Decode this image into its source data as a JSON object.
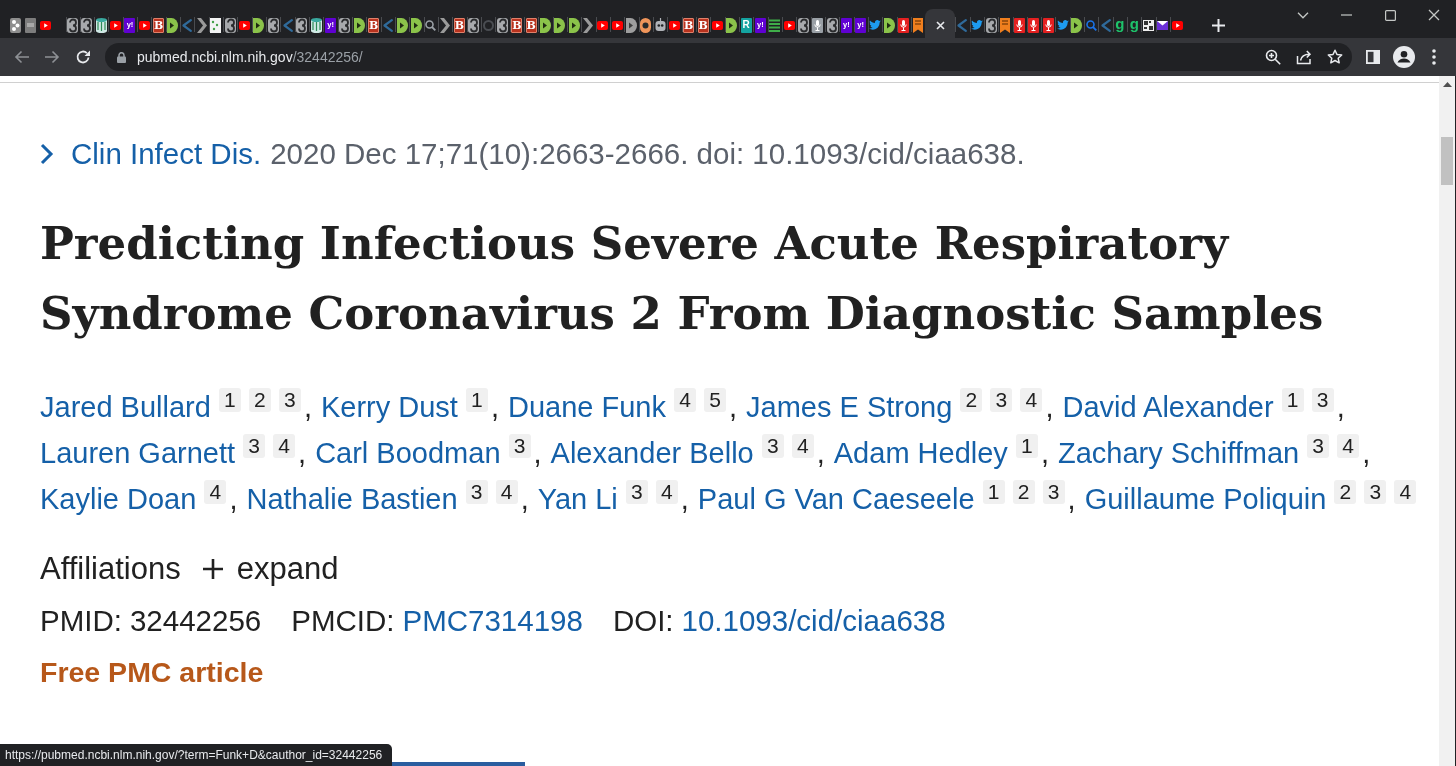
{
  "tab_strip": {
    "pinned_tabs": [
      {
        "kind": "dots-tile",
        "selected": false
      },
      {
        "kind": "gray-tile",
        "selected": false
      },
      {
        "kind": "youtube",
        "selected": false
      }
    ],
    "tabs": [
      {
        "kind": "swirl",
        "selected": false
      },
      {
        "kind": "swirl",
        "selected": false
      },
      {
        "kind": "cylinder",
        "selected": false
      },
      {
        "kind": "youtube",
        "selected": false
      },
      {
        "kind": "yahoo",
        "glyph": "y!",
        "selected": false
      },
      {
        "kind": "youtube",
        "selected": false
      },
      {
        "kind": "b-tile",
        "glyph": "B",
        "selected": false
      },
      {
        "kind": "green-play",
        "selected": false
      },
      {
        "kind": "blue-chevron",
        "selected": false
      },
      {
        "kind": "gray-chevron",
        "selected": false
      },
      {
        "kind": "doc",
        "selected": false
      },
      {
        "kind": "swirl",
        "selected": false
      },
      {
        "kind": "youtube",
        "selected": false
      },
      {
        "kind": "green-play",
        "selected": false
      },
      {
        "kind": "swirl",
        "selected": false
      },
      {
        "kind": "blue-chevron",
        "selected": false
      },
      {
        "kind": "swirl",
        "selected": false
      },
      {
        "kind": "cylinder",
        "selected": false
      },
      {
        "kind": "yahoo",
        "glyph": "y!",
        "selected": false
      },
      {
        "kind": "swirl",
        "selected": false
      },
      {
        "kind": "green-play",
        "selected": false
      },
      {
        "kind": "b-tile",
        "glyph": "B",
        "selected": false
      },
      {
        "kind": "blue-chevron",
        "selected": false
      },
      {
        "kind": "green-play",
        "selected": false
      },
      {
        "kind": "green-play",
        "selected": false
      },
      {
        "kind": "search",
        "selected": false
      },
      {
        "kind": "gray-chevron",
        "selected": false
      },
      {
        "kind": "b-tile",
        "glyph": "B",
        "selected": false
      },
      {
        "kind": "swirl",
        "selected": false
      },
      {
        "kind": "ring",
        "selected": false
      },
      {
        "kind": "swirl",
        "selected": false
      },
      {
        "kind": "b-tile",
        "glyph": "B",
        "selected": false
      },
      {
        "kind": "b-tile",
        "glyph": "B",
        "selected": false
      },
      {
        "kind": "green-play",
        "selected": false
      },
      {
        "kind": "green-play",
        "selected": false
      },
      {
        "kind": "green-play",
        "selected": false
      },
      {
        "kind": "gray-chevron",
        "selected": false
      },
      {
        "kind": "youtube",
        "selected": false
      },
      {
        "kind": "youtube",
        "selected": false
      },
      {
        "kind": "gray-play",
        "selected": false
      },
      {
        "kind": "orange-ring",
        "selected": false
      },
      {
        "kind": "robot",
        "selected": false
      },
      {
        "kind": "youtube",
        "selected": false
      },
      {
        "kind": "b-tile",
        "glyph": "B",
        "selected": false
      },
      {
        "kind": "b-tile",
        "glyph": "B",
        "selected": false
      },
      {
        "kind": "youtube",
        "selected": false
      },
      {
        "kind": "green-play",
        "selected": false
      },
      {
        "kind": "r-tile",
        "glyph": "R",
        "selected": false
      },
      {
        "kind": "yahoo",
        "glyph": "y!",
        "selected": false
      },
      {
        "kind": "list",
        "selected": false
      },
      {
        "kind": "youtube",
        "selected": false
      },
      {
        "kind": "swirl",
        "selected": false
      },
      {
        "kind": "mic-gray",
        "selected": false
      },
      {
        "kind": "swirl",
        "selected": false
      },
      {
        "kind": "yahoo",
        "glyph": "y!",
        "selected": false
      },
      {
        "kind": "yahoo",
        "glyph": "y!",
        "selected": false
      },
      {
        "kind": "twitter",
        "selected": false
      },
      {
        "kind": "green-play",
        "selected": false
      },
      {
        "kind": "mic",
        "selected": false
      },
      {
        "kind": "bookmark",
        "selected": false
      },
      {
        "selected": true
      },
      {
        "kind": "blue-chevron",
        "selected": false
      },
      {
        "kind": "twitter",
        "selected": false
      },
      {
        "kind": "swirl",
        "selected": false
      },
      {
        "kind": "bookmark",
        "selected": false
      },
      {
        "kind": "mic",
        "selected": false
      },
      {
        "kind": "mic",
        "selected": false
      },
      {
        "kind": "mic",
        "selected": false
      },
      {
        "kind": "twitter",
        "selected": false
      },
      {
        "kind": "green-play",
        "selected": false
      },
      {
        "kind": "search-blue",
        "selected": false
      },
      {
        "kind": "blue-chevron",
        "selected": false
      },
      {
        "kind": "g-letter",
        "glyph": "g",
        "selected": false
      },
      {
        "kind": "g-letter",
        "glyph": "g",
        "selected": false
      },
      {
        "kind": "pattern",
        "selected": false
      },
      {
        "kind": "mail",
        "selected": false
      },
      {
        "kind": "youtube",
        "selected": false
      }
    ]
  },
  "toolbar": {
    "address_bar": {
      "host": "pubmed.ncbi.nlm.nih.gov",
      "path": "/32442256/"
    }
  },
  "article": {
    "journal": "Clin Infect Dis.",
    "citation": "2020 Dec 17;71(10):2663-2666. doi: 10.1093/cid/ciaa638.",
    "title": "Predicting Infectious Severe Acute Respiratory Syndrome Coronavirus 2 From Diagnostic Samples",
    "authors": [
      {
        "name": "Jared Bullard",
        "affiliations": [
          "1",
          "2",
          "3"
        ],
        "separator": ","
      },
      {
        "name": "Kerry Dust",
        "affiliations": [
          "1"
        ],
        "separator": ","
      },
      {
        "name": "Duane Funk",
        "affiliations": [
          "4",
          "5"
        ],
        "separator": ","
      },
      {
        "name": "James E Strong",
        "affiliations": [
          "2",
          "3",
          "4"
        ],
        "separator": ","
      },
      {
        "name": "David Alexander",
        "affiliations": [
          "1",
          "3"
        ],
        "separator": ","
      },
      {
        "name": "Lauren Garnett",
        "affiliations": [
          "3",
          "4"
        ],
        "separator": ","
      },
      {
        "name": "Carl Boodman",
        "affiliations": [
          "3"
        ],
        "separator": ","
      },
      {
        "name": "Alexander Bello",
        "affiliations": [
          "3",
          "4"
        ],
        "separator": ","
      },
      {
        "name": "Adam Hedley",
        "affiliations": [
          "1"
        ],
        "separator": ","
      },
      {
        "name": "Zachary Schiffman",
        "affiliations": [
          "3",
          "4"
        ],
        "separator": ","
      },
      {
        "name": "Kaylie Doan",
        "affiliations": [
          "4"
        ],
        "separator": ","
      },
      {
        "name": "Nathalie Bastien",
        "affiliations": [
          "3",
          "4"
        ],
        "separator": ","
      },
      {
        "name": "Yan Li",
        "affiliations": [
          "3",
          "4"
        ],
        "separator": ","
      },
      {
        "name": "Paul G Van Caeseele",
        "affiliations": [
          "1",
          "2",
          "3"
        ],
        "separator": ","
      },
      {
        "name": "Guillaume Poliquin",
        "affiliations": [
          "2",
          "3",
          "4"
        ]
      }
    ],
    "affiliations": {
      "label": "Affiliations",
      "toggle": "expand"
    },
    "identifiers": [
      {
        "label": "PMID:",
        "value": "32442256",
        "link": false
      },
      {
        "label": "PMCID:",
        "value": "PMC7314198",
        "link": true
      },
      {
        "label": "DOI:",
        "value": "10.1093/cid/ciaa638",
        "link": true
      }
    ],
    "free_article": "Free PMC article"
  },
  "status_bubble": "https://pubmed.ncbi.nlm.nih.gov/?term=Funk+D&cauthor_id=32442256"
}
